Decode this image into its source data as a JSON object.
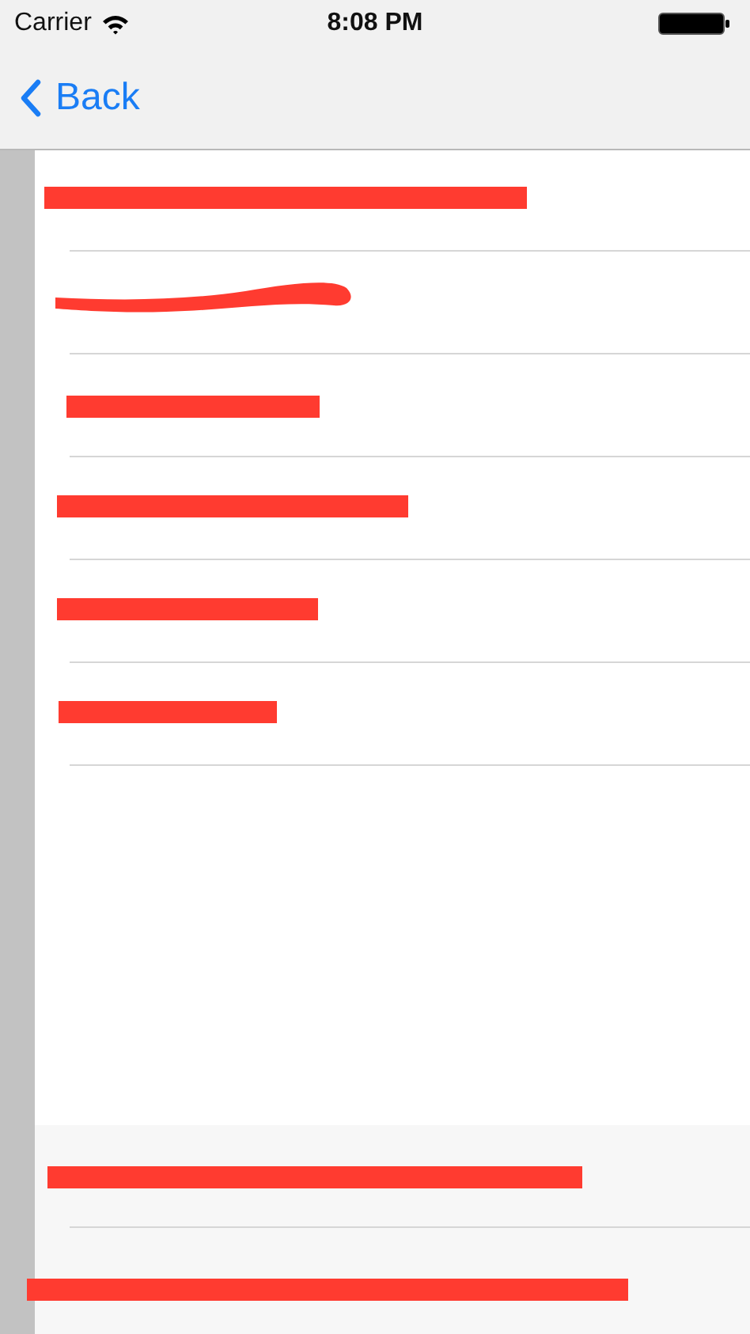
{
  "status_bar": {
    "carrier": "Carrier",
    "time": "8:08 PM"
  },
  "nav_bar": {
    "back_label": "Back"
  },
  "list": {
    "rows": [
      {
        "kind": "bar"
      },
      {
        "kind": "scribble"
      },
      {
        "kind": "bar"
      },
      {
        "kind": "bar"
      },
      {
        "kind": "bar"
      },
      {
        "kind": "bar"
      }
    ]
  },
  "footer": {
    "rows": [
      {
        "kind": "bar"
      },
      {
        "kind": "bar"
      }
    ]
  }
}
